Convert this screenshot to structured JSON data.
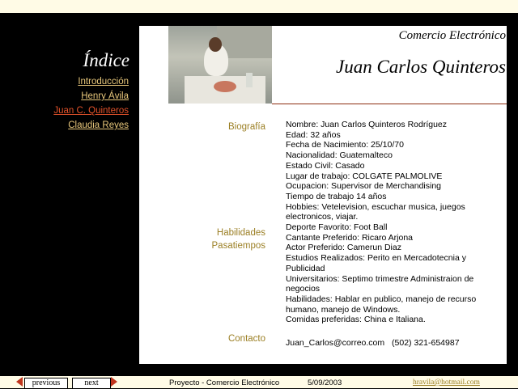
{
  "header": {
    "brand": "Comercio Electrónico",
    "title": "Juan Carlos Quinteros"
  },
  "sidebar": {
    "index_title": "Índice",
    "items": [
      {
        "label": "Introducción",
        "current": false
      },
      {
        "label": "Henry Ávila",
        "current": false
      },
      {
        "label": "Juan C. Quinteros",
        "current": true
      },
      {
        "label": "Claudia Reyes",
        "current": false
      }
    ]
  },
  "sections": {
    "biografia": "Biografía",
    "habilidades": "Habilidades",
    "pasatiempos": "Pasatiempos",
    "contacto": "Contacto"
  },
  "bio_lines": [
    "Nombre: Juan Carlos Quinteros Rodríguez",
    "Edad: 32 años",
    "Fecha de Nacimiento: 25/10/70",
    "Nacionalidad: Guatemalteco",
    "Estado Civil: Casado",
    "Lugar de trabajo: COLGATE PALMOLIVE",
    "Ocupacion: Supervisor de Merchandising",
    "Tiempo de trabajo 14 años",
    "Hobbies: Vetelevision, escuchar musica, juegos electronicos, viajar.",
    "Deporte Favorito: Foot Ball",
    "Cantante Preferido: Ricaro Arjona",
    "Actor Preferido: Camerun Diaz",
    "Estudios Realizados: Perito en Mercadotecnia y Publicidad",
    "Universitarios: Septimo trimestre Administraion de negocios",
    "Habilidades: Hablar en publico, manejo de recurso humano, manejo de Windows.",
    "Comidas preferidas: China e Italiana."
  ],
  "contact": {
    "email": "Juan_Carlos@correo.com",
    "phone": "(502) 321-654987"
  },
  "footer": {
    "previous": "previous",
    "next": "next",
    "project": "Proyecto - Comercio Electrónico",
    "date": "5/09/2003",
    "email": "hravila@hotmail.com"
  },
  "colors": {
    "accent_gold": "#9b7f24",
    "nav_link": "#e8c77b",
    "nav_current": "#e2522a",
    "rule": "#8b2c0f"
  }
}
